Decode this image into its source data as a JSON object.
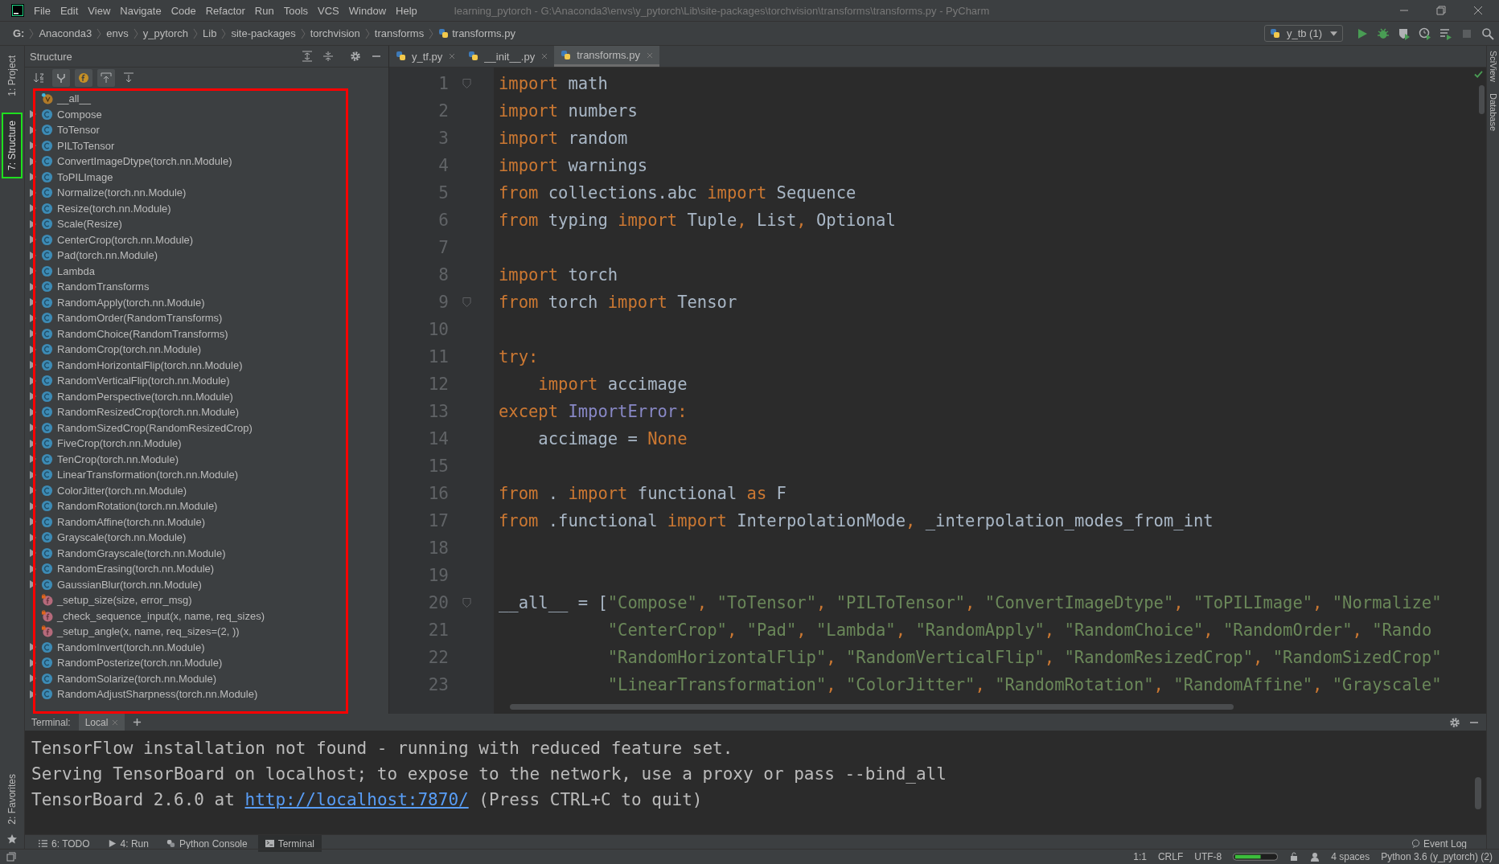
{
  "menu_bar": {
    "items": [
      "File",
      "Edit",
      "View",
      "Navigate",
      "Code",
      "Refactor",
      "Run",
      "Tools",
      "VCS",
      "Window",
      "Help"
    ],
    "title": "learning_pytorch - G:\\Anaconda3\\envs\\y_pytorch\\Lib\\site-packages\\torchvision\\transforms\\transforms.py - PyCharm"
  },
  "breadcrumbs": [
    "G:",
    "Anaconda3",
    "envs",
    "y_pytorch",
    "Lib",
    "site-packages",
    "torchvision",
    "transforms",
    "transforms.py"
  ],
  "run_config": "y_tb (1)",
  "left_side_tabs": [
    {
      "label": "1: Project",
      "selected": false
    },
    {
      "label": "7: Structure",
      "selected": true
    }
  ],
  "left_bottom_tab": "2: Favorites",
  "right_side_tabs": [
    "SciView",
    "Database"
  ],
  "structure": {
    "title": "Structure",
    "toolbar": [
      {
        "kind": "sort",
        "on": false
      },
      {
        "kind": "inherited",
        "on": true
      },
      {
        "kind": "fields",
        "on": true
      },
      {
        "kind": "scroll-to",
        "on": true
      },
      {
        "kind": "scroll-from",
        "on": false
      }
    ],
    "items": [
      {
        "kind": "variable",
        "label": "__all__"
      },
      {
        "kind": "class",
        "label": "Compose"
      },
      {
        "kind": "class",
        "label": "ToTensor"
      },
      {
        "kind": "class",
        "label": "PILToTensor"
      },
      {
        "kind": "class",
        "label": "ConvertImageDtype(torch.nn.Module)"
      },
      {
        "kind": "class",
        "label": "ToPILImage"
      },
      {
        "kind": "class",
        "label": "Normalize(torch.nn.Module)"
      },
      {
        "kind": "class",
        "label": "Resize(torch.nn.Module)"
      },
      {
        "kind": "class",
        "label": "Scale(Resize)"
      },
      {
        "kind": "class",
        "label": "CenterCrop(torch.nn.Module)"
      },
      {
        "kind": "class",
        "label": "Pad(torch.nn.Module)"
      },
      {
        "kind": "class",
        "label": "Lambda"
      },
      {
        "kind": "class",
        "label": "RandomTransforms"
      },
      {
        "kind": "class",
        "label": "RandomApply(torch.nn.Module)"
      },
      {
        "kind": "class",
        "label": "RandomOrder(RandomTransforms)"
      },
      {
        "kind": "class",
        "label": "RandomChoice(RandomTransforms)"
      },
      {
        "kind": "class",
        "label": "RandomCrop(torch.nn.Module)"
      },
      {
        "kind": "class",
        "label": "RandomHorizontalFlip(torch.nn.Module)"
      },
      {
        "kind": "class",
        "label": "RandomVerticalFlip(torch.nn.Module)"
      },
      {
        "kind": "class",
        "label": "RandomPerspective(torch.nn.Module)"
      },
      {
        "kind": "class",
        "label": "RandomResizedCrop(torch.nn.Module)"
      },
      {
        "kind": "class",
        "label": "RandomSizedCrop(RandomResizedCrop)"
      },
      {
        "kind": "class",
        "label": "FiveCrop(torch.nn.Module)"
      },
      {
        "kind": "class",
        "label": "TenCrop(torch.nn.Module)"
      },
      {
        "kind": "class",
        "label": "LinearTransformation(torch.nn.Module)"
      },
      {
        "kind": "class",
        "label": "ColorJitter(torch.nn.Module)"
      },
      {
        "kind": "class",
        "label": "RandomRotation(torch.nn.Module)"
      },
      {
        "kind": "class",
        "label": "RandomAffine(torch.nn.Module)"
      },
      {
        "kind": "class",
        "label": "Grayscale(torch.nn.Module)"
      },
      {
        "kind": "class",
        "label": "RandomGrayscale(torch.nn.Module)"
      },
      {
        "kind": "class",
        "label": "RandomErasing(torch.nn.Module)"
      },
      {
        "kind": "class",
        "label": "GaussianBlur(torch.nn.Module)"
      },
      {
        "kind": "function",
        "label": "_setup_size(size, error_msg)"
      },
      {
        "kind": "function",
        "label": "_check_sequence_input(x, name, req_sizes)"
      },
      {
        "kind": "function",
        "label": "_setup_angle(x, name, req_sizes=(2, ))"
      },
      {
        "kind": "class",
        "label": "RandomInvert(torch.nn.Module)"
      },
      {
        "kind": "class",
        "label": "RandomPosterize(torch.nn.Module)"
      },
      {
        "kind": "class",
        "label": "RandomSolarize(torch.nn.Module)"
      },
      {
        "kind": "class",
        "label": "RandomAdjustSharpness(torch.nn.Module)"
      }
    ]
  },
  "editor": {
    "tabs": [
      {
        "label": "y_tf.py",
        "selected": false
      },
      {
        "label": "__init__.py",
        "selected": false
      },
      {
        "label": "transforms.py",
        "selected": true
      }
    ],
    "lines": [
      {
        "n": "1",
        "fold": true,
        "tokens": [
          {
            "kind": "keyword",
            "text": "import"
          },
          {
            "kind": "plain",
            "text": " math"
          }
        ]
      },
      {
        "n": "2",
        "fold": false,
        "tokens": [
          {
            "kind": "keyword",
            "text": "import"
          },
          {
            "kind": "plain",
            "text": " numbers"
          }
        ]
      },
      {
        "n": "3",
        "fold": false,
        "tokens": [
          {
            "kind": "keyword",
            "text": "import"
          },
          {
            "kind": "plain",
            "text": " random"
          }
        ]
      },
      {
        "n": "4",
        "fold": false,
        "tokens": [
          {
            "kind": "keyword",
            "text": "import"
          },
          {
            "kind": "plain",
            "text": " warnings"
          }
        ]
      },
      {
        "n": "5",
        "fold": false,
        "tokens": [
          {
            "kind": "keyword",
            "text": "from"
          },
          {
            "kind": "plain",
            "text": " collections.abc "
          },
          {
            "kind": "keyword",
            "text": "import"
          },
          {
            "kind": "plain",
            "text": " Sequence"
          }
        ]
      },
      {
        "n": "6",
        "fold": false,
        "tokens": [
          {
            "kind": "keyword",
            "text": "from"
          },
          {
            "kind": "plain",
            "text": " typing "
          },
          {
            "kind": "keyword",
            "text": "import"
          },
          {
            "kind": "plain",
            "text": " Tuple"
          },
          {
            "kind": "keyword",
            "text": ", "
          },
          {
            "kind": "plain",
            "text": "List"
          },
          {
            "kind": "keyword",
            "text": ", "
          },
          {
            "kind": "plain",
            "text": "Optional"
          }
        ]
      },
      {
        "n": "7",
        "fold": false
      },
      {
        "n": "8",
        "fold": false,
        "tokens": [
          {
            "kind": "keyword",
            "text": "import"
          },
          {
            "kind": "plain",
            "text": " torch"
          }
        ]
      },
      {
        "n": "9",
        "fold": true,
        "tokens": [
          {
            "kind": "keyword",
            "text": "from"
          },
          {
            "kind": "plain",
            "text": " torch "
          },
          {
            "kind": "keyword",
            "text": "import"
          },
          {
            "kind": "plain",
            "text": " Tensor"
          }
        ]
      },
      {
        "n": "10",
        "fold": false
      },
      {
        "n": "11",
        "fold": false,
        "tokens": [
          {
            "kind": "keyword",
            "text": "try:"
          }
        ]
      },
      {
        "n": "12",
        "fold": false,
        "tokens": [
          {
            "kind": "keyword",
            "text": "    import"
          },
          {
            "kind": "plain",
            "text": " accimage"
          }
        ]
      },
      {
        "n": "13",
        "fold": false,
        "tokens": [
          {
            "kind": "keyword",
            "text": "except"
          },
          {
            "kind": "builtin",
            "text": " ImportError"
          },
          {
            "kind": "keyword",
            "text": ":"
          }
        ]
      },
      {
        "n": "14",
        "fold": false,
        "tokens": [
          {
            "kind": "plain",
            "text": "    accimage = "
          },
          {
            "kind": "keyword",
            "text": "None"
          }
        ]
      },
      {
        "n": "15",
        "fold": false
      },
      {
        "n": "16",
        "fold": false,
        "tokens": [
          {
            "kind": "keyword",
            "text": "from"
          },
          {
            "kind": "plain",
            "text": " . "
          },
          {
            "kind": "keyword",
            "text": "import"
          },
          {
            "kind": "plain",
            "text": " functional "
          },
          {
            "kind": "keyword",
            "text": "as"
          },
          {
            "kind": "plain",
            "text": " F"
          }
        ]
      },
      {
        "n": "17",
        "fold": false,
        "tokens": [
          {
            "kind": "keyword",
            "text": "from"
          },
          {
            "kind": "plain",
            "text": " .functional "
          },
          {
            "kind": "keyword",
            "text": "import"
          },
          {
            "kind": "plain",
            "text": " InterpolationMode"
          },
          {
            "kind": "keyword",
            "text": ", "
          },
          {
            "kind": "plain",
            "text": "_interpolation_modes_from_int"
          }
        ]
      },
      {
        "n": "18",
        "fold": false
      },
      {
        "n": "19",
        "fold": false
      },
      {
        "n": "20",
        "fold": true,
        "tokens": [
          {
            "kind": "plain",
            "text": "__all__ = ["
          },
          {
            "kind": "string",
            "text": "\"Compose\""
          },
          {
            "kind": "keyword",
            "text": ", "
          },
          {
            "kind": "string",
            "text": "\"ToTensor\""
          },
          {
            "kind": "keyword",
            "text": ", "
          },
          {
            "kind": "string",
            "text": "\"PILToTensor\""
          },
          {
            "kind": "keyword",
            "text": ", "
          },
          {
            "kind": "string",
            "text": "\"ConvertImageDtype\""
          },
          {
            "kind": "keyword",
            "text": ", "
          },
          {
            "kind": "string",
            "text": "\"ToPILImage\""
          },
          {
            "kind": "keyword",
            "text": ", "
          },
          {
            "kind": "string",
            "text": "\"Normalize\""
          }
        ]
      },
      {
        "n": "21",
        "fold": false,
        "tokens": [
          {
            "kind": "string",
            "text": "           \"CenterCrop\""
          },
          {
            "kind": "keyword",
            "text": ", "
          },
          {
            "kind": "string",
            "text": "\"Pad\""
          },
          {
            "kind": "keyword",
            "text": ", "
          },
          {
            "kind": "string",
            "text": "\"Lambda\""
          },
          {
            "kind": "keyword",
            "text": ", "
          },
          {
            "kind": "string",
            "text": "\"RandomApply\""
          },
          {
            "kind": "keyword",
            "text": ", "
          },
          {
            "kind": "string",
            "text": "\"RandomChoice\""
          },
          {
            "kind": "keyword",
            "text": ", "
          },
          {
            "kind": "string",
            "text": "\"RandomOrder\""
          },
          {
            "kind": "keyword",
            "text": ", "
          },
          {
            "kind": "string",
            "text": "\"Rando"
          }
        ]
      },
      {
        "n": "22",
        "fold": false,
        "tokens": [
          {
            "kind": "string",
            "text": "           \"RandomHorizontalFlip\""
          },
          {
            "kind": "keyword",
            "text": ", "
          },
          {
            "kind": "string",
            "text": "\"RandomVerticalFlip\""
          },
          {
            "kind": "keyword",
            "text": ", "
          },
          {
            "kind": "string",
            "text": "\"RandomResizedCrop\""
          },
          {
            "kind": "keyword",
            "text": ", "
          },
          {
            "kind": "string",
            "text": "\"RandomSizedCrop\""
          }
        ]
      },
      {
        "n": "23",
        "fold": false,
        "tokens": [
          {
            "kind": "string",
            "text": "           \"LinearTransformation\""
          },
          {
            "kind": "keyword",
            "text": ", "
          },
          {
            "kind": "string",
            "text": "\"ColorJitter\""
          },
          {
            "kind": "keyword",
            "text": ", "
          },
          {
            "kind": "string",
            "text": "\"RandomRotation\""
          },
          {
            "kind": "keyword",
            "text": ", "
          },
          {
            "kind": "string",
            "text": "\"RandomAffine\""
          },
          {
            "kind": "keyword",
            "text": ", "
          },
          {
            "kind": "string",
            "text": "\"Grayscale\""
          }
        ]
      }
    ]
  },
  "terminal": {
    "label": "Terminal:",
    "tabs": [
      {
        "label": "Local",
        "selected": true
      }
    ],
    "lines": [
      {
        "kind": "text",
        "text": "TensorFlow installation not found - running with reduced feature set."
      },
      {
        "kind": "text",
        "text": "Serving TensorBoard on localhost; to expose to the network, use a proxy or pass --bind_all"
      },
      {
        "kind": "link",
        "before": "TensorBoard 2.6.0 at ",
        "link": "http://localhost:7870/",
        "after": " (Press CTRL+C to quit)"
      }
    ]
  },
  "tool_windows": [
    {
      "kind": "todo",
      "label": "6: TODO",
      "selected": false
    },
    {
      "kind": "run",
      "label": "4: Run",
      "selected": false
    },
    {
      "kind": "console",
      "label": "Python Console",
      "selected": false
    },
    {
      "kind": "terminal",
      "label": "Terminal",
      "selected": true
    }
  ],
  "event_log": "Event Log",
  "status_bar": {
    "position": "1:1",
    "line_separator": "CRLF",
    "encoding": "UTF-8",
    "indent": "4 spaces",
    "interpreter": "Python 3.6 (y_pytorch) (2)"
  }
}
